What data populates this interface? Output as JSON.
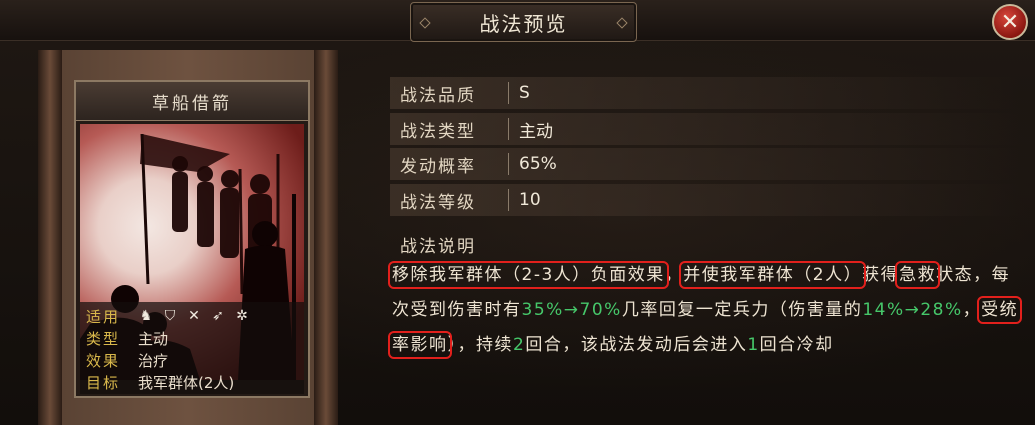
{
  "header": {
    "title": "战法预览",
    "close_icon": "close-icon"
  },
  "card": {
    "name": "草船借箭",
    "art_icon": "soldiers-silhouette-illustration",
    "rows": [
      {
        "label": "适用",
        "value": "",
        "icons": [
          "cavalry-icon",
          "shield-icon",
          "bow-icon",
          "spear-icon",
          "wheel-icon"
        ]
      },
      {
        "label": "类型",
        "value": "主动"
      },
      {
        "label": "效果",
        "value": "治疗"
      },
      {
        "label": "目标",
        "value": "我军群体(2人)"
      }
    ]
  },
  "details": {
    "rows": [
      {
        "label": "战法品质",
        "value": "S"
      },
      {
        "label": "战法类型",
        "value": "主动"
      },
      {
        "label": "发动概率",
        "value": "65%"
      },
      {
        "label": "战法等级",
        "value": "10"
      }
    ],
    "desc_label": "战法说明",
    "desc": {
      "p1": "移除我军群体（2-3人）负面效果",
      "p2": "，",
      "p3": "并使我军群体（2人）",
      "p4": "获得",
      "p5": "急救",
      "p6": "状态，每次受到伤害时有",
      "p7": "35%→70%",
      "p8": "几率回复一定兵力（伤害量的",
      "p9": "14%→28%",
      "p10": "，",
      "p11": "受统率影响",
      "p12": "），持续",
      "p13": "2",
      "p14": "回合，该战法发动后会进入",
      "p15": "1",
      "p16": "回合冷却"
    },
    "accent_green": "#46c76a",
    "highlight_red": "#e2201c"
  }
}
